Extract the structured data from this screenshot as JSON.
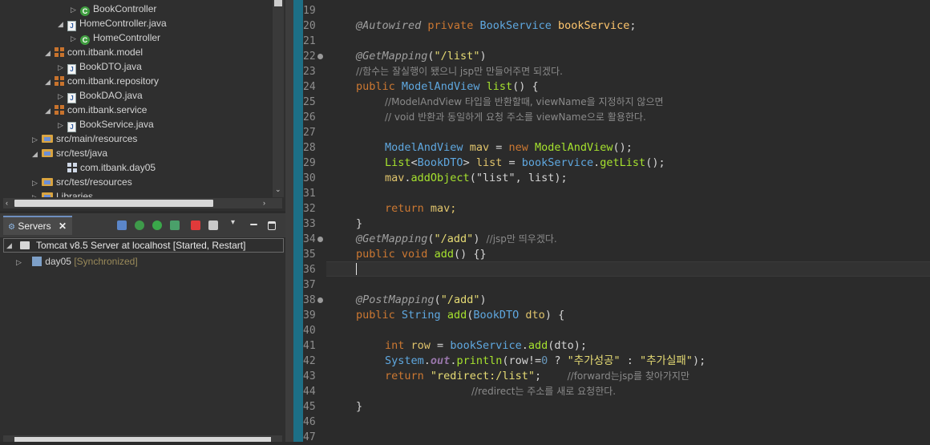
{
  "explorer": {
    "items": [
      {
        "label": "BookController",
        "icon": "class-icon",
        "twisty": "▷"
      },
      {
        "label": "HomeController.java",
        "icon": "java-file-icon",
        "twisty": "◢"
      },
      {
        "label": "HomeController",
        "icon": "class-icon",
        "twisty": "▷"
      },
      {
        "label": "com.itbank.model",
        "icon": "package-icon",
        "twisty": "◢"
      },
      {
        "label": "BookDTO.java",
        "icon": "java-file-icon",
        "twisty": "▷"
      },
      {
        "label": "com.itbank.repository",
        "icon": "package-icon",
        "twisty": "◢"
      },
      {
        "label": "BookDAO.java",
        "icon": "java-file-icon",
        "twisty": "▷"
      },
      {
        "label": "com.itbank.service",
        "icon": "package-icon",
        "twisty": "◢"
      },
      {
        "label": "BookService.java",
        "icon": "java-file-icon",
        "twisty": "▷"
      },
      {
        "label": "src/main/resources",
        "icon": "source-folder-icon",
        "twisty": "▷"
      },
      {
        "label": "src/test/java",
        "icon": "source-folder-icon",
        "twisty": "◢"
      },
      {
        "label": "com.itbank.day05",
        "icon": "empty-package-icon",
        "twisty": ""
      },
      {
        "label": "src/test/resources",
        "icon": "source-folder-icon",
        "twisty": "▷"
      },
      {
        "label": "Libraries",
        "icon": "library-icon",
        "twisty": "▷"
      }
    ]
  },
  "servers": {
    "tab_label": "Servers",
    "tab_close": "✕",
    "server": "Tomcat v8.5 Server at localhost  [Started, Restart]",
    "module": "day05",
    "module_state": "[Synchronized]"
  },
  "editor": {
    "line_numbers": [
      "19",
      "20",
      "21",
      "22",
      "23",
      "24",
      "25",
      "26",
      "27",
      "28",
      "29",
      "30",
      "31",
      "32",
      "33",
      "34",
      "35",
      "36",
      "37",
      "38",
      "39",
      "40",
      "41",
      "42",
      "43",
      "44",
      "45",
      "46",
      "47"
    ],
    "lines": {
      "l20": {
        "ann": "@Autowired",
        "kw": "private",
        "type": "BookService",
        "name": "bookService",
        "end": ";"
      },
      "l22": {
        "ann": "@GetMapping",
        "open": "(",
        "str": "\"/list\"",
        "close": ")"
      },
      "l23": {
        "comment": "//함수는 잘실행이 됐으니 jsp만 만들어주면 되겠다."
      },
      "l24": {
        "kw": "public",
        "type": "ModelAndView",
        "name": "list",
        "rest": "() {"
      },
      "l25": {
        "comment": "//ModelAndView 타입을 반환할때, viewName을 지정하지 않으면"
      },
      "l26": {
        "comment": "// void 반환과 동일하게 요청 주소를 viewName으로 활용한다."
      },
      "l28": {
        "type": "ModelAndView",
        "var": "mav",
        "eq": " = ",
        "kw": "new",
        "ctor": "ModelAndView",
        "end": "();"
      },
      "l29": {
        "type": "List",
        "gen": "BookDTO",
        "var": "list",
        "eq": " = ",
        "obj": "bookService",
        "dot": ".",
        "call": "getList",
        "end": "();"
      },
      "l30": {
        "obj": "mav",
        "dot": ".",
        "call": "addObject",
        "args": "(\"list\", list);"
      },
      "l32": {
        "kw": "return",
        "rest": "mav;"
      },
      "l33": {
        "text": "}"
      },
      "l34": {
        "ann": "@GetMapping",
        "open": "(",
        "str": "\"/add\"",
        "close": ")",
        "comment": "//jsp만 띄우겠다."
      },
      "l35": {
        "kw": "public",
        "kw2": "void",
        "name": "add",
        "rest": "() {}"
      },
      "l38": {
        "ann": "@PostMapping",
        "open": "(",
        "str": "\"/add\"",
        "close": ")"
      },
      "l39": {
        "kw": "public",
        "type": "String",
        "name": "add",
        "open": "(",
        "ptype": "BookDTO",
        "param": "dto",
        "rest": ") {"
      },
      "l41": {
        "kw": "int",
        "var": "row",
        "eq": " = ",
        "obj": "bookService",
        "dot": ".",
        "call": "add",
        "args": "(dto);"
      },
      "l42": {
        "obj": "System",
        "field": "out",
        "call": "println",
        "open": "(row!=",
        "num": "0",
        "q": " ? ",
        "s1": "\"추가성공\"",
        "c": " : ",
        "s2": "\"추가실패\"",
        "end": ");"
      },
      "l43": {
        "kw": "return",
        "str": "\"redirect:/list\"",
        "end": ";",
        "comment": "//forward는jsp를 찾아가지만"
      },
      "l44": {
        "comment": "//redirect는 주소를 새로 요청한다."
      },
      "l45": {
        "text": "}"
      }
    }
  }
}
